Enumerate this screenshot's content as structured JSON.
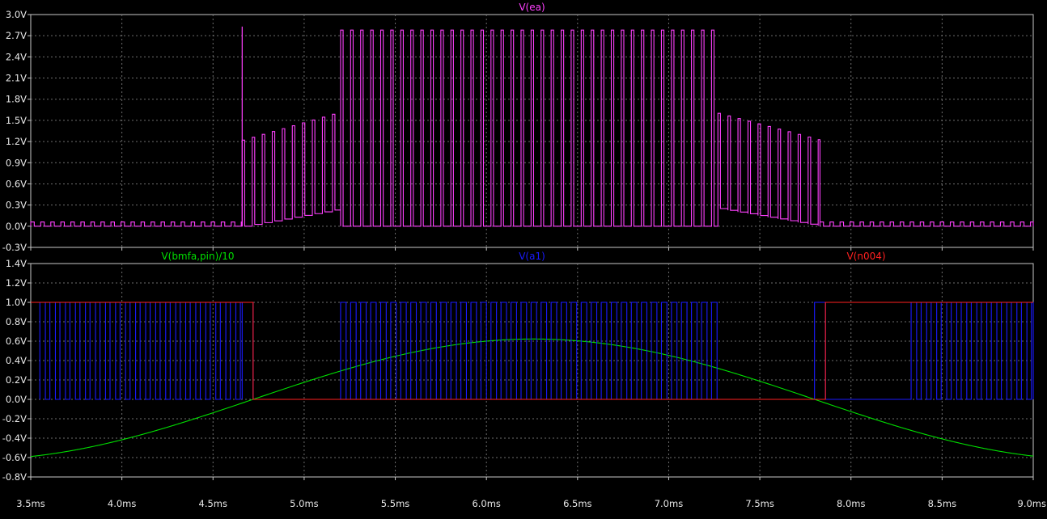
{
  "chart_data": {
    "type": "line",
    "x_axis": {
      "ticks": [
        "3.5ms",
        "4.0ms",
        "4.5ms",
        "5.0ms",
        "5.5ms",
        "6.0ms",
        "6.5ms",
        "7.0ms",
        "7.5ms",
        "8.0ms",
        "8.5ms",
        "9.0ms"
      ],
      "range": [
        3.5,
        9.0
      ],
      "unit": "ms"
    },
    "panes": [
      {
        "ylim": [
          -0.3,
          3.0
        ],
        "y_ticks": [
          "3.0V",
          "2.7V",
          "2.4V",
          "2.1V",
          "1.8V",
          "1.5V",
          "1.2V",
          "0.9V",
          "0.6V",
          "0.3V",
          "0.0V",
          "-0.3V"
        ],
        "grid": true,
        "series": [
          {
            "name": "V(ea)",
            "color": "#ff40ff",
            "waveform": "pwm",
            "pwm_period_ms": 0.055,
            "segments": [
              {
                "x_start": 3.5,
                "x_end": 4.66,
                "high": 0.06,
                "low": 0.0,
                "duty": 0.35
              },
              {
                "x_start": 4.66,
                "x_end": 5.2,
                "high_start": 1.22,
                "high_end": 1.62,
                "low_start": 0.0,
                "low_end": 0.25,
                "duty": 0.25
              },
              {
                "x_start": 5.2,
                "x_end": 7.27,
                "high": 2.78,
                "low": 0.0,
                "duty": 0.25
              },
              {
                "x_start": 7.27,
                "x_end": 7.83,
                "high_start": 1.6,
                "high_end": 1.22,
                "low_start": 0.25,
                "low_end": 0.0,
                "duty": 0.25
              },
              {
                "x_start": 7.83,
                "x_end": 9.0,
                "high": 0.06,
                "low": 0.0,
                "duty": 0.35
              }
            ],
            "spike": {
              "x": 4.66,
              "y": 2.83
            }
          }
        ]
      },
      {
        "ylim": [
          -0.8,
          1.4
        ],
        "y_ticks": [
          "1.4V",
          "1.2V",
          "1.0V",
          "0.8V",
          "0.6V",
          "0.4V",
          "0.2V",
          "0.0V",
          "-0.2V",
          "-0.4V",
          "-0.6V",
          "-0.8V"
        ],
        "grid": true,
        "series": [
          {
            "name": "V(bmfa,pin)/10",
            "color": "#00e000",
            "waveform": "sine",
            "amplitude": 0.622,
            "peak_x": 6.26,
            "zero_crossings": [
              4.72,
              7.8
            ],
            "x": [
              3.5,
              4.0,
              4.5,
              4.72,
              5.0,
              5.5,
              6.0,
              6.26,
              6.5,
              7.0,
              7.5,
              7.8,
              8.0,
              8.5,
              9.0
            ],
            "y": [
              -0.58,
              -0.4,
              -0.13,
              0.0,
              0.21,
              0.47,
              0.61,
              0.622,
              0.61,
              0.48,
              0.21,
              0.0,
              -0.14,
              -0.42,
              -0.59
            ]
          },
          {
            "name": "V(a1)",
            "color": "#1a1aff",
            "waveform": "pwm",
            "pwm_period_ms": 0.055,
            "high": 1.0,
            "low": 0.0,
            "duty": 0.55,
            "bursts": [
              [
                3.55,
                4.66
              ],
              [
                5.2,
                7.27
              ],
              [
                8.33,
                9.0
              ]
            ],
            "steps": [
              {
                "x_start": 4.66,
                "x_end": 4.72,
                "level": 1.0
              },
              {
                "x_start": 4.72,
                "x_end": 5.2,
                "level": 0.0
              },
              {
                "x_start": 7.27,
                "x_end": 7.8,
                "level": 0.0
              },
              {
                "x_start": 7.8,
                "x_end": 7.86,
                "level": 1.0
              },
              {
                "x_start": 7.86,
                "x_end": 8.33,
                "level": 0.0
              }
            ]
          },
          {
            "name": "V(n004)",
            "color": "#ff2020",
            "waveform": "step",
            "x": [
              3.5,
              4.72,
              4.72,
              7.86,
              7.86,
              9.0
            ],
            "y": [
              1.0,
              1.0,
              0.0,
              0.0,
              1.0,
              1.0
            ]
          }
        ]
      }
    ]
  }
}
